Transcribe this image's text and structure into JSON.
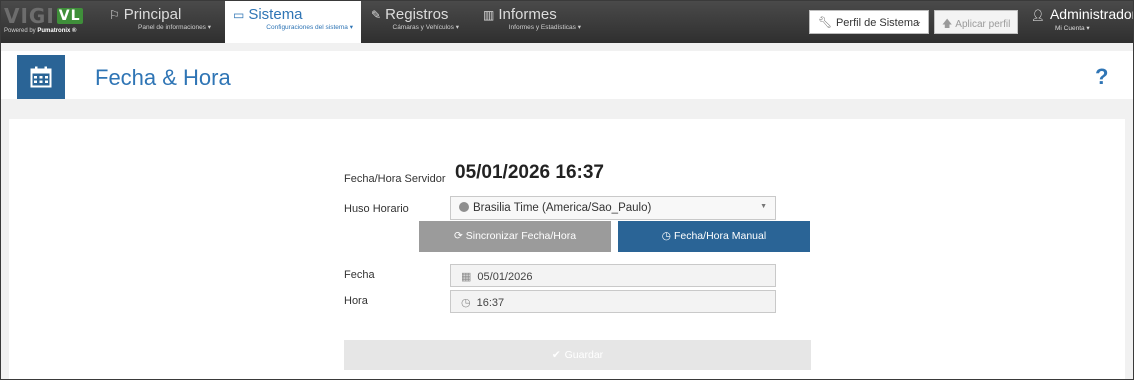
{
  "logo": {
    "brand_a": "VIGI",
    "brand_b": "VL",
    "powered_prefix": "Powered by ",
    "powered_brand": "Pumatronix ®"
  },
  "nav": {
    "items": [
      {
        "label": "Principal",
        "sublabel": "Panel de informaciones ▾",
        "icon": "flag-icon",
        "glyph": "⚐"
      },
      {
        "label": "Sistema",
        "sublabel": "Configuraciones del sistema ▾",
        "icon": "monitor-icon",
        "glyph": "▭"
      },
      {
        "label": "Registros",
        "sublabel": "Cámaras y Vehículos ▾",
        "icon": "edit-icon",
        "glyph": "✎"
      },
      {
        "label": "Informes",
        "sublabel": "Informes y Estadísticas ▾",
        "icon": "bar-chart-icon",
        "glyph": "▥"
      }
    ],
    "active_index": 1
  },
  "toolbar": {
    "profile_select_value": "Perfil de Sistema",
    "apply_profile_label": "Aplicar perfil"
  },
  "user": {
    "name": "Administrador",
    "sublabel": "Mi Cuenta ▾"
  },
  "page": {
    "title": "Fecha & Hora",
    "help_symbol": "?"
  },
  "form": {
    "server_label": "Fecha/Hora Servidor",
    "server_value": "05/01/2026 16:37",
    "timezone_label": "Huso Horario",
    "timezone_value": "Brasilia Time (America/Sao_Paulo)",
    "sync_button": "Sincronizar Fecha/Hora",
    "manual_button": "Fecha/Hora Manual",
    "date_label": "Fecha",
    "date_value": "05/01/2026",
    "time_label": "Hora",
    "time_value": "16:37",
    "save_button": "Guardar"
  },
  "colors": {
    "accent": "#2f75b5",
    "header_icon_bg": "#2a6496",
    "navbar_bg": "#3a3a3a",
    "sync_bg": "#9b9b9b"
  }
}
